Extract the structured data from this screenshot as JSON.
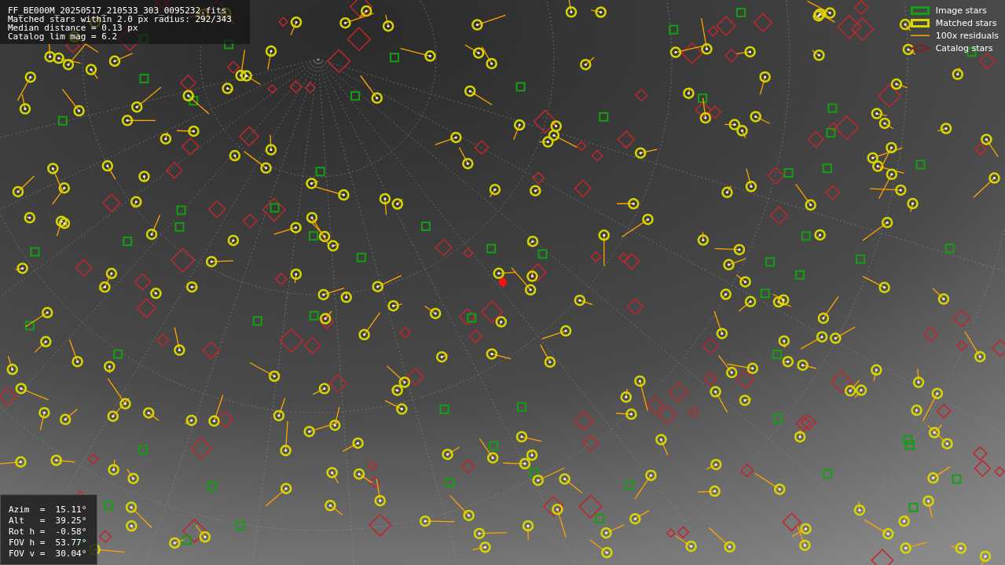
{
  "info_box": {
    "lines": [
      "FF_BE000M_20250517_210533_303_0095232.fits",
      "Matched stars within 2.0 px radius: 292/343",
      "Median distance = 0.13 px",
      "Catalog lim mag = 6.2"
    ]
  },
  "legend": {
    "items": [
      {
        "kind": "image",
        "label": "Image stars"
      },
      {
        "kind": "matched",
        "label": "Matched stars"
      },
      {
        "kind": "residual",
        "label": "100x residuals"
      },
      {
        "kind": "catalog",
        "label": "Catalog stars"
      }
    ]
  },
  "pointing_box": {
    "lines": [
      "Azim  =  15.11°",
      "Alt   =  39.25°",
      "Rot h =  -0.58°",
      "FOV h =  53.77°",
      "FOV v =  30.04°"
    ]
  }
}
